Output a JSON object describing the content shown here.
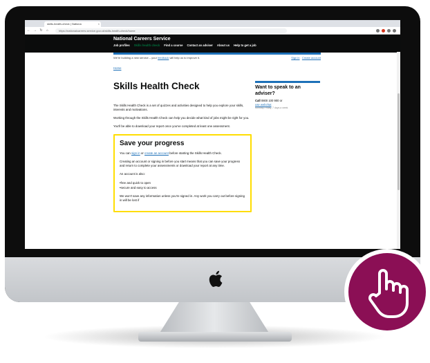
{
  "browser": {
    "tab_title": "skills-health-check | Nationa",
    "tab_close": "×",
    "url": "https://nationalcareers.service.gov.uk/skills-health-check/home",
    "icons": [
      "back-icon",
      "forward-icon",
      "reload-icon",
      "home-icon"
    ]
  },
  "site": {
    "service_name": "National Careers Service",
    "nav": [
      "Job profiles",
      "Skills health check",
      "Find a course",
      "Contact an adviser",
      "About us",
      "Help to get a job"
    ],
    "active_nav_color": "#00703c",
    "beta_prefix": "We're building a new service – your",
    "beta_link": "feedback",
    "beta_suffix": "will help us to improve it.",
    "sign_in": "Sign in",
    "create_account": "Create account",
    "breadcrumb": "Home"
  },
  "main": {
    "title": "Skills Health Check",
    "intro_1": "The Skills Health Check is a set of quizzes and activities designed to help you explore your skills, interests and motivations.",
    "intro_2": "Working through the Skills Health Check can help you decide what kind of jobs might be right for you.",
    "intro_3": "You'll be able to download your report once you've completed at least one assessment.",
    "inset": {
      "heading": "Save your progress",
      "p1_prefix": "You can",
      "p1_link1": "sign in",
      "p1_mid": "or",
      "p1_link2": "create an account",
      "p1_suffix": "before starting the Skills Health Check.",
      "p2": "Creating an account or signing in before you start means that you can save your progress and return to complete your assessments or download your report at any time.",
      "p3": "An account is also:",
      "bullets": [
        "free and quick to open",
        "secure and easy to access"
      ],
      "p4": "We won't save any information unless you're signed in. Any work you carry out before signing in will be lost if"
    }
  },
  "aside": {
    "heading": "Want to speak to an adviser?",
    "call_label": "Call",
    "phone": "0800 100 900",
    "or": "or",
    "webchat": "use webchat",
    "hours": "Monday-Friday, 7 days a week"
  },
  "colors": {
    "header_bg": "#0b0c0c",
    "gov_blue": "#1d70b8",
    "inset_border": "#ffdd00",
    "badge": "#8b0f55"
  }
}
